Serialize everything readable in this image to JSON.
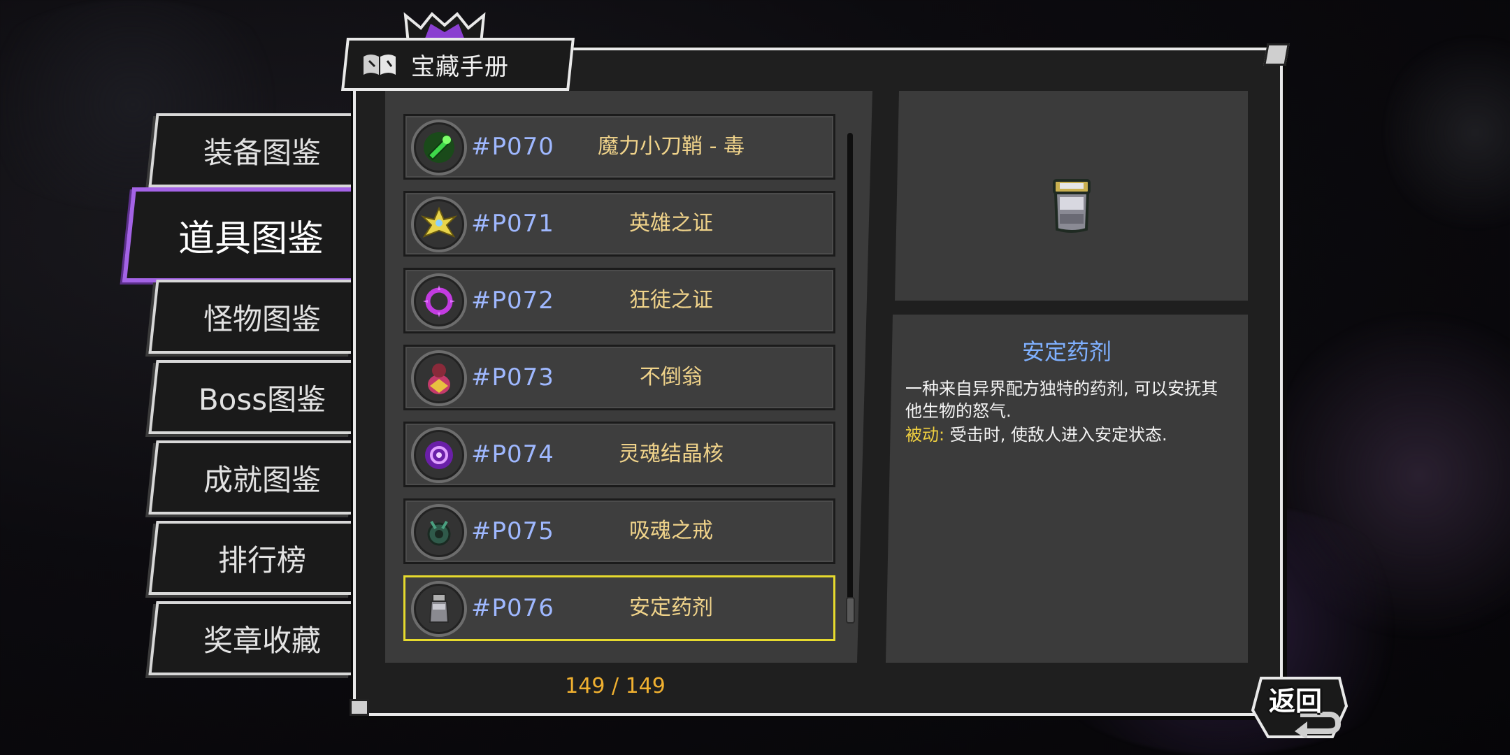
{
  "window": {
    "title": "宝藏手册"
  },
  "menu": {
    "items": [
      {
        "label": "装备图鉴",
        "active": false
      },
      {
        "label": "道具图鉴",
        "active": true
      },
      {
        "label": "怪物图鉴",
        "active": false
      },
      {
        "label": "Boss图鉴",
        "active": false
      },
      {
        "label": "成就图鉴",
        "active": false
      },
      {
        "label": "排行榜",
        "active": false
      },
      {
        "label": "奖章收藏",
        "active": false
      }
    ]
  },
  "list": {
    "rows": [
      {
        "code": "#P070",
        "name": "魔力小刀鞘 - 毒",
        "icon": "green-poison-dagger-sheath-icon"
      },
      {
        "code": "#P071",
        "name": "英雄之证",
        "icon": "gold-hero-emblem-icon"
      },
      {
        "code": "#P072",
        "name": "狂徒之证",
        "icon": "purple-spiked-ring-icon"
      },
      {
        "code": "#P073",
        "name": "不倒翁",
        "icon": "tumbler-doll-icon"
      },
      {
        "code": "#P074",
        "name": "灵魂结晶核",
        "icon": "purple-soul-crystal-icon"
      },
      {
        "code": "#P075",
        "name": "吸魂之戒",
        "icon": "green-soul-ring-icon"
      },
      {
        "code": "#P076",
        "name": "安定药剂",
        "icon": "potion-bottle-icon",
        "selected": true
      }
    ],
    "counter": "149 / 149"
  },
  "detail": {
    "title": "安定药剂",
    "description": "一种来自异界配方独特的药剂, 可以安抚其他生物的怒气.",
    "passive_label": "被动:",
    "passive_text": " 受击时, 使敌人进入安定状态."
  },
  "back_button": {
    "label": "返回"
  },
  "colors": {
    "active_tab": "#a463e6",
    "selected_row": "#e6da2e",
    "item_code": "#9fb8ff",
    "item_name": "#f0d38a",
    "counter": "#f0b030",
    "detail_title": "#7fb0ff",
    "passive_label": "#f0d040"
  }
}
